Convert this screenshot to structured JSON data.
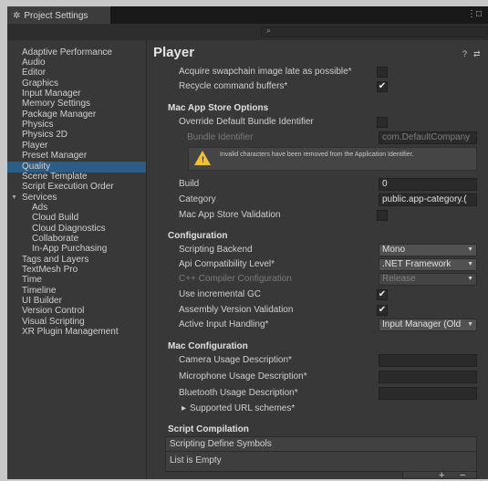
{
  "window": {
    "tab_title": "Project Settings",
    "tab_icon": "gear-icon",
    "menu_icon": "⋮",
    "maximize_icon": "□",
    "close_icon": "x"
  },
  "search": {
    "icon": "search-icon",
    "glyph": "⌕",
    "value": ""
  },
  "sidebar": {
    "items": [
      {
        "label": "Adaptive Performance"
      },
      {
        "label": "Audio"
      },
      {
        "label": "Editor"
      },
      {
        "label": "Graphics"
      },
      {
        "label": "Input Manager"
      },
      {
        "label": "Memory Settings"
      },
      {
        "label": "Package Manager"
      },
      {
        "label": "Physics"
      },
      {
        "label": "Physics 2D"
      },
      {
        "label": "Player",
        "selected": true
      },
      {
        "label": "Preset Manager"
      },
      {
        "label": "Quality"
      },
      {
        "label": "Scene Template"
      },
      {
        "label": "Script Execution Order"
      },
      {
        "label": "Services",
        "expanded": true
      },
      {
        "label": "Ads"
      },
      {
        "label": "Cloud Build"
      },
      {
        "label": "Cloud Diagnostics"
      },
      {
        "label": "Collaborate"
      },
      {
        "label": "In-App Purchasing"
      },
      {
        "label": "Tags and Layers"
      },
      {
        "label": "TextMesh Pro"
      },
      {
        "label": "Time"
      },
      {
        "label": "Timeline"
      },
      {
        "label": "UI Builder"
      },
      {
        "label": "Version Control"
      },
      {
        "label": "Visual Scripting"
      },
      {
        "label": "XR Plugin Management"
      }
    ],
    "selected_color": "#2c5d87"
  },
  "main": {
    "title": "Player",
    "help_icon": "?",
    "settings_icon": "⇄",
    "rows": {
      "acquire_swapchain": {
        "label": "Acquire swapchain image late as possible*",
        "checked": false
      },
      "recycle_buffers": {
        "label": "Recycle command buffers*",
        "checked": true
      },
      "mac_app_store_header": "Mac App Store Options",
      "override_bundle": {
        "label": "Override Default Bundle Identifier",
        "checked": false
      },
      "bundle_identifier": {
        "label": "Bundle Identifier",
        "value": "com.DefaultCompany"
      },
      "warning": "Invalid characters have been removed from the Application Identifier.",
      "build": {
        "label": "Build",
        "value": "0"
      },
      "category": {
        "label": "Category",
        "value": "public.app-category.("
      },
      "mac_app_store_validation": {
        "label": "Mac App Store Validation",
        "checked": false
      },
      "configuration_header": "Configuration",
      "scripting_backend": {
        "label": "Scripting Backend",
        "value": "Mono"
      },
      "api_compat": {
        "label": "Api Compatibility Level*",
        "value": ".NET Framework"
      },
      "cpp_compiler": {
        "label": "C++ Compiler Configuration",
        "value": "Release"
      },
      "incremental_gc": {
        "label": "Use incremental GC",
        "checked": true
      },
      "assembly_validation": {
        "label": "Assembly Version Validation",
        "checked": true
      },
      "active_input": {
        "label": "Active Input Handling*",
        "value": "Input Manager (Old"
      },
      "mac_config_header": "Mac Configuration",
      "camera_usage": {
        "label": "Camera Usage Description*",
        "value": ""
      },
      "microphone_usage": {
        "label": "Microphone Usage Description*",
        "value": ""
      },
      "bluetooth_usage": {
        "label": "Bluetooth Usage Description*",
        "value": ""
      },
      "supported_url": {
        "label": "Supported URL schemes*"
      },
      "script_compilation_header": "Script Compilation",
      "define_symbols_header": "Scripting Define Symbols",
      "list_empty": "List is Empty",
      "add": "+",
      "remove": "−"
    }
  },
  "colors": {
    "warning": "#f1c232",
    "selection": "#2c5d87"
  }
}
